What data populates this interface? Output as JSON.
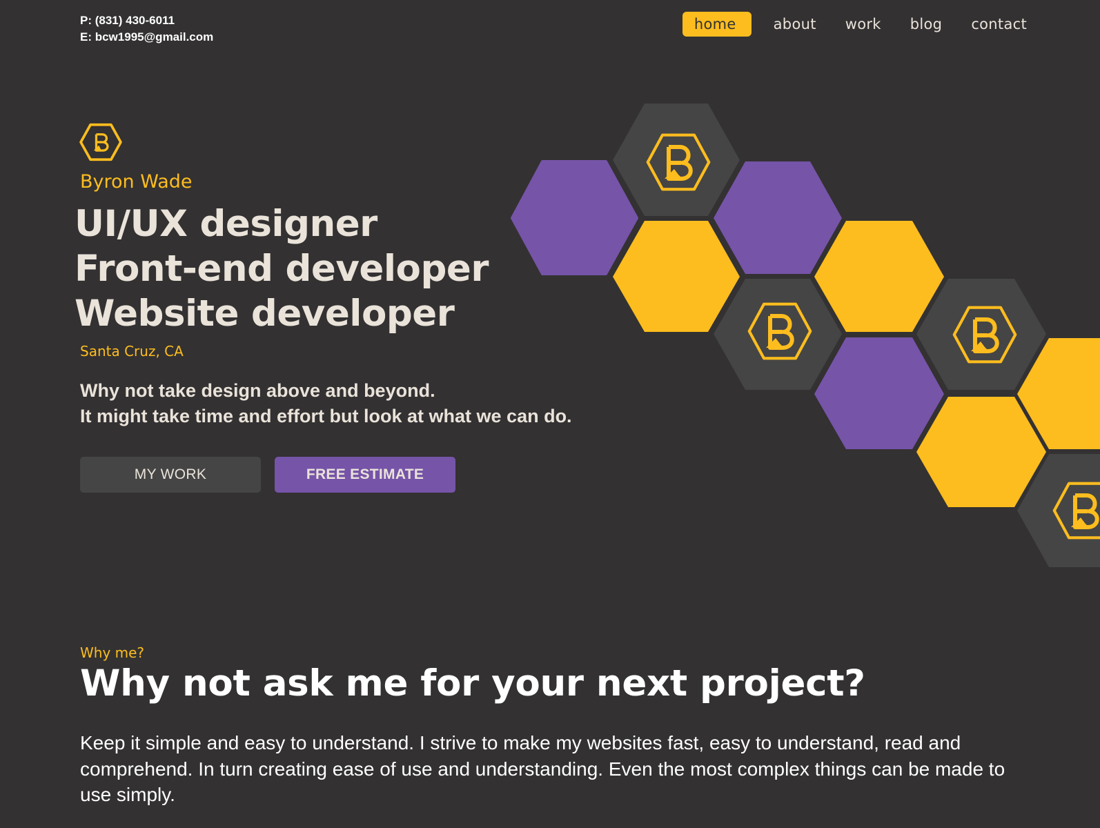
{
  "contact": {
    "phone": "P: (831) 430-6011",
    "email": "E: bcw1995@gmail.com"
  },
  "nav": {
    "items": [
      {
        "label": "home",
        "active": true
      },
      {
        "label": "about",
        "active": false
      },
      {
        "label": "work",
        "active": false
      },
      {
        "label": "blog",
        "active": false
      },
      {
        "label": "contact",
        "active": false
      }
    ]
  },
  "hero": {
    "logo_icon": "hexagon-b-logo-icon",
    "name": "Byron Wade",
    "roles": [
      "UI/UX designer",
      "Front-end developer",
      "Website developer"
    ],
    "location": "Santa Cruz, CA",
    "tagline": [
      "Why not take design above and beyond.",
      "It might take time and effort but look at what we can do."
    ],
    "buttons": {
      "my_work": "MY WORK",
      "free_estimate": "FREE ESTIMATE"
    }
  },
  "why": {
    "eyebrow": "Why me?",
    "title": "Why not ask me for your next project?",
    "body": "Keep it simple and easy to understand. I strive to make my websites fast, easy to understand, read and comprehend. In turn creating ease of use and understanding. Even the most complex things can be made to use simply."
  },
  "colors": {
    "background": "#333132",
    "accent_yellow": "#fdbd1e",
    "accent_purple": "#7654a8",
    "dark_hex": "#454545",
    "text_light": "#eae3da"
  }
}
